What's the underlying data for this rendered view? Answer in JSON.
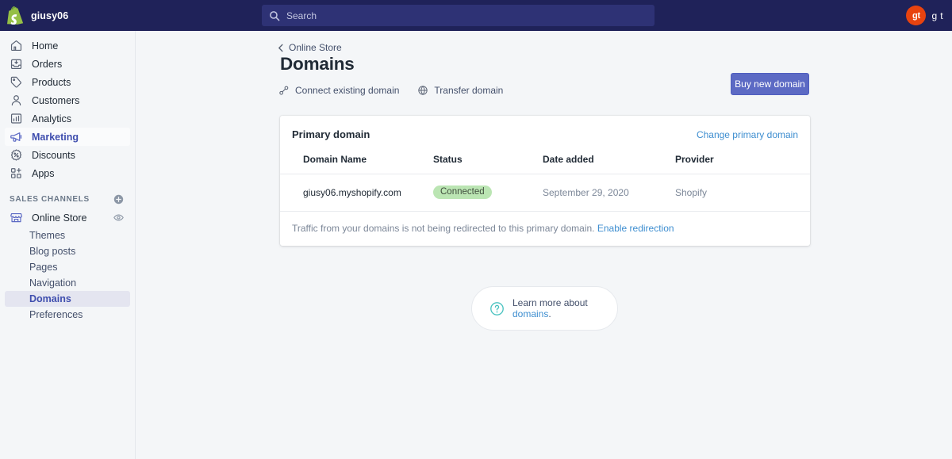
{
  "topbar": {
    "store_name": "giusy06",
    "logo_icon": "shopify-bag-icon",
    "search": {
      "placeholder": "Search",
      "value": "",
      "icon": "search-icon"
    },
    "avatar_initials": "gt",
    "user_name": "g t"
  },
  "sidebar": {
    "nav": [
      {
        "label": "Home",
        "icon": "home-icon",
        "hovered": false
      },
      {
        "label": "Orders",
        "icon": "orders-inbox-icon",
        "hovered": false
      },
      {
        "label": "Products",
        "icon": "product-tag-icon",
        "hovered": false
      },
      {
        "label": "Customers",
        "icon": "customer-person-icon",
        "hovered": false
      },
      {
        "label": "Analytics",
        "icon": "analytics-bars-icon",
        "hovered": false
      },
      {
        "label": "Marketing",
        "icon": "marketing-megaphone-icon",
        "hovered": true
      },
      {
        "label": "Discounts",
        "icon": "discount-percent-icon",
        "hovered": false
      },
      {
        "label": "Apps",
        "icon": "apps-grid-icon",
        "hovered": false
      }
    ],
    "sales_channels_title": "SALES CHANNELS",
    "add_channel_icon": "plus-circle-icon",
    "channel": {
      "label": "Online Store",
      "icon": "storefront-icon",
      "view_icon": "eye-icon"
    },
    "subnav": [
      {
        "label": "Themes",
        "active": false
      },
      {
        "label": "Blog posts",
        "active": false
      },
      {
        "label": "Pages",
        "active": false
      },
      {
        "label": "Navigation",
        "active": false
      },
      {
        "label": "Domains",
        "active": true
      },
      {
        "label": "Preferences",
        "active": false
      }
    ]
  },
  "main": {
    "breadcrumb": {
      "label": "Online Store",
      "icon": "chevron-left-icon"
    },
    "title": "Domains",
    "actions": [
      {
        "label": "Connect existing domain",
        "icon": "link-chain-icon"
      },
      {
        "label": "Transfer domain",
        "icon": "globe-icon"
      }
    ],
    "buy_button": "Buy new domain",
    "card": {
      "title": "Primary domain",
      "change_link": "Change primary domain",
      "columns": [
        "Domain Name",
        "Status",
        "Date added",
        "Provider"
      ],
      "rows": [
        {
          "domain": "giusy06.myshopify.com",
          "status": "Connected",
          "status_color": "#bbe5b3",
          "date_added": "September 29, 2020",
          "provider": "Shopify"
        }
      ],
      "footer_text": "Traffic from your domains is not being redirected to this primary domain.",
      "footer_link": "Enable redirection"
    },
    "learn_banner": {
      "icon": "question-circle-icon",
      "text": "Learn more about ",
      "link": "domains",
      "suffix": "."
    }
  },
  "colors": {
    "topbar_bg": "#1f2259",
    "accent_button": "#5c6ac4",
    "link_blue": "#3e8ed0",
    "active_nav": "#3f4eae",
    "avatar_bg": "#e8430f",
    "badge_green": "#bbe5b3",
    "page_bg": "#f4f6f8"
  }
}
